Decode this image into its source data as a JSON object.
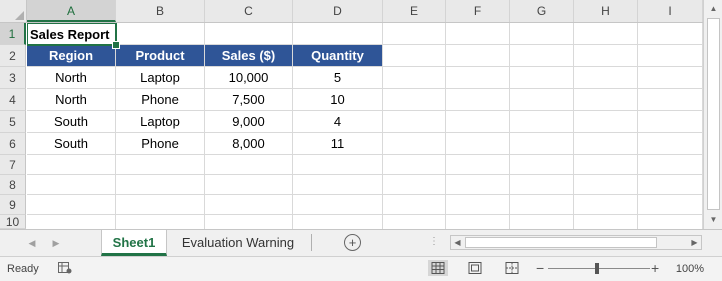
{
  "spreadsheet": {
    "columns": [
      "A",
      "B",
      "C",
      "D",
      "E",
      "F",
      "G",
      "H",
      "I"
    ],
    "rows": [
      "1",
      "2",
      "3",
      "4",
      "5",
      "6",
      "7",
      "8",
      "9",
      "10"
    ],
    "active_cell": "A1",
    "title": "Sales Report",
    "header": [
      "Region",
      "Product",
      "Sales ($)",
      "Quantity"
    ],
    "data": [
      [
        "North",
        "Laptop",
        "10,000",
        "5"
      ],
      [
        "North",
        "Phone",
        "7,500",
        "10"
      ],
      [
        "South",
        "Laptop",
        "9,000",
        "4"
      ],
      [
        "South",
        "Phone",
        "8,000",
        "11"
      ]
    ],
    "header_fill_color": "#2f5597",
    "header_text_color": "#ffffff",
    "accent_color": "#217346"
  },
  "sheet_tabs": {
    "tabs": [
      {
        "label": "Sheet1",
        "active": true
      },
      {
        "label": "Evaluation Warning",
        "active": false
      }
    ],
    "add_sheet_icon": "plus-circle-icon",
    "nav_prev_icon": "triangle-left-icon",
    "nav_next_icon": "triangle-right-icon"
  },
  "status_bar": {
    "status": "Ready",
    "macro_icon": "record-macro-icon",
    "views": [
      "normal-view-icon",
      "page-layout-view-icon",
      "page-break-preview-icon"
    ],
    "active_view": "normal-view-icon",
    "zoom_minus": "−",
    "zoom_plus": "+",
    "zoom_level": "100%"
  }
}
